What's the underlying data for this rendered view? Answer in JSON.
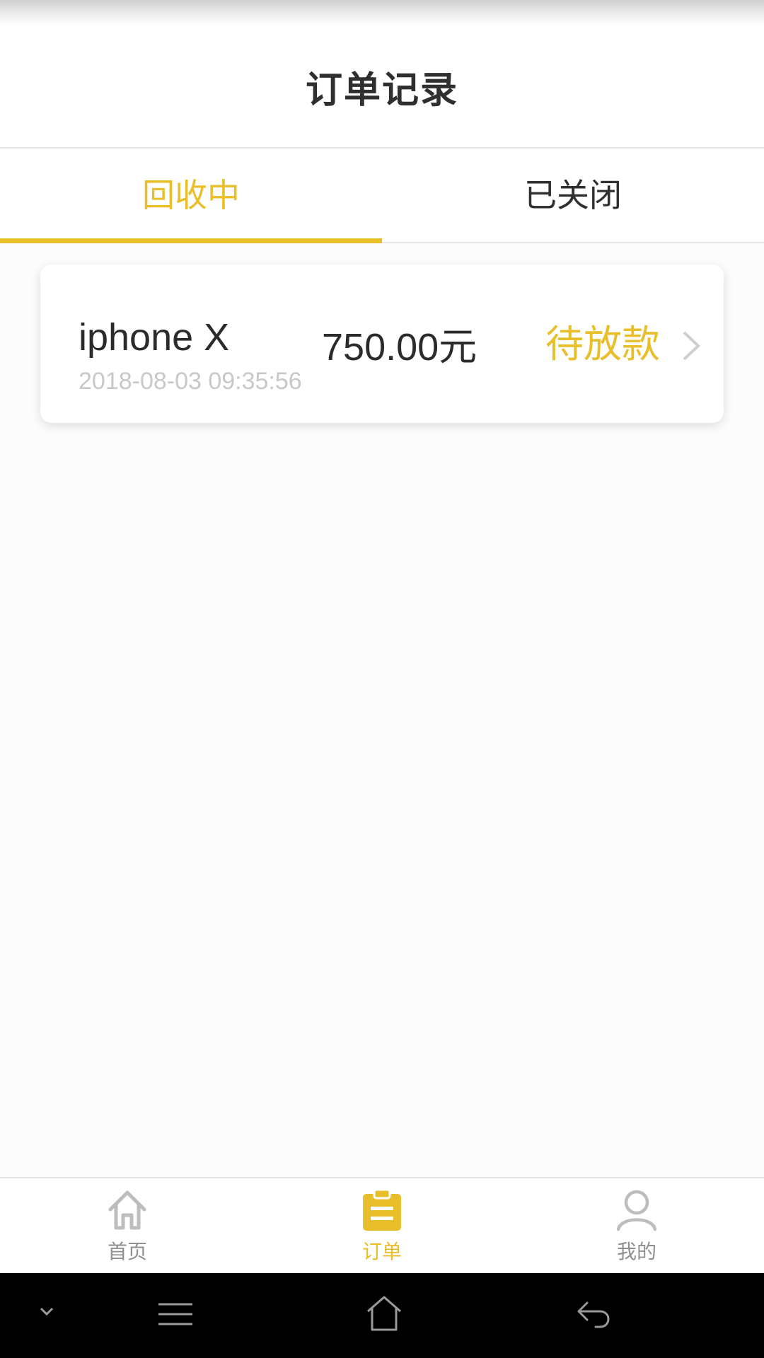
{
  "header": {
    "title": "订单记录"
  },
  "tabs": [
    {
      "label": "回收中",
      "active": true
    },
    {
      "label": "已关闭",
      "active": false
    }
  ],
  "orders": [
    {
      "name": "iphone X",
      "price": "750.00元",
      "status": "待放款",
      "date": "2018-08-03 09:35:56"
    }
  ],
  "bottom_nav": {
    "items": [
      {
        "label": "首页",
        "icon": "home-icon",
        "active": false
      },
      {
        "label": "订单",
        "icon": "clipboard-icon",
        "active": true
      },
      {
        "label": "我的",
        "icon": "user-icon",
        "active": false
      }
    ]
  },
  "system_nav": {
    "buttons": [
      "chevron-down-icon",
      "menu-icon",
      "home-icon",
      "back-icon"
    ]
  },
  "colors": {
    "accent": "#e8bf2a",
    "text": "#2b2b2b",
    "muted": "#c8c8c8",
    "nav_inactive": "#8f8f8f"
  }
}
